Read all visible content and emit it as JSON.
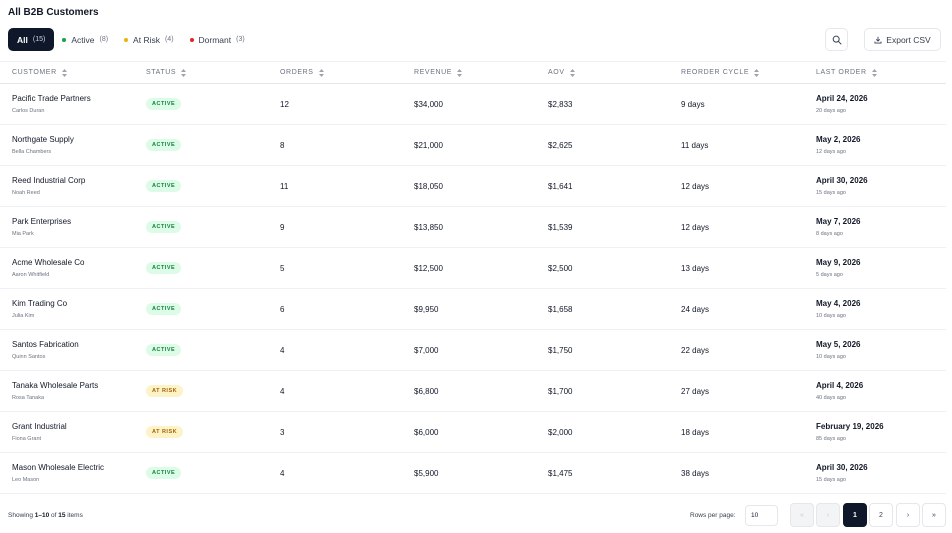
{
  "page": {
    "title": "All B2B Customers"
  },
  "filters": [
    {
      "label": "All",
      "count": "(15)",
      "dot": ""
    },
    {
      "label": "Active",
      "count": "(8)",
      "dot": "#16a34a"
    },
    {
      "label": "At Risk",
      "count": "(4)",
      "dot": "#eab308"
    },
    {
      "label": "Dormant",
      "count": "(3)",
      "dot": "#dc2626"
    }
  ],
  "toolbar": {
    "export_label": "Export CSV",
    "search_icon": "search-icon",
    "download_icon": "download-icon"
  },
  "columns": [
    "CUSTOMER",
    "STATUS",
    "ORDERS",
    "REVENUE",
    "AOV",
    "REORDER CYCLE",
    "LAST ORDER"
  ],
  "rows": [
    {
      "name": "Pacific Trade Partners",
      "contact": "Carlos Duran",
      "status": "ACTIVE",
      "status_kind": "active",
      "orders": "12",
      "revenue": "$34,000",
      "aov": "$2,833",
      "cycle": "9 days",
      "last_order": "April 24, 2026",
      "ago": "20 days ago"
    },
    {
      "name": "Northgate Supply",
      "contact": "Bella Chambers",
      "status": "ACTIVE",
      "status_kind": "active",
      "orders": "8",
      "revenue": "$21,000",
      "aov": "$2,625",
      "cycle": "11 days",
      "last_order": "May 2, 2026",
      "ago": "12 days ago"
    },
    {
      "name": "Reed Industrial Corp",
      "contact": "Noah Reed",
      "status": "ACTIVE",
      "status_kind": "active",
      "orders": "11",
      "revenue": "$18,050",
      "aov": "$1,641",
      "cycle": "12 days",
      "last_order": "April 30, 2026",
      "ago": "15 days ago"
    },
    {
      "name": "Park Enterprises",
      "contact": "Mia Park",
      "status": "ACTIVE",
      "status_kind": "active",
      "orders": "9",
      "revenue": "$13,850",
      "aov": "$1,539",
      "cycle": "12 days",
      "last_order": "May 7, 2026",
      "ago": "8 days ago"
    },
    {
      "name": "Acme Wholesale Co",
      "contact": "Aaron Whitfield",
      "status": "ACTIVE",
      "status_kind": "active",
      "orders": "5",
      "revenue": "$12,500",
      "aov": "$2,500",
      "cycle": "13 days",
      "last_order": "May 9, 2026",
      "ago": "5 days ago"
    },
    {
      "name": "Kim Trading Co",
      "contact": "Julia Kim",
      "status": "ACTIVE",
      "status_kind": "active",
      "orders": "6",
      "revenue": "$9,950",
      "aov": "$1,658",
      "cycle": "24 days",
      "last_order": "May 4, 2026",
      "ago": "10 days ago"
    },
    {
      "name": "Santos Fabrication",
      "contact": "Quinn Santos",
      "status": "ACTIVE",
      "status_kind": "active",
      "orders": "4",
      "revenue": "$7,000",
      "aov": "$1,750",
      "cycle": "22 days",
      "last_order": "May 5, 2026",
      "ago": "10 days ago"
    },
    {
      "name": "Tanaka Wholesale Parts",
      "contact": "Rosa Tanaka",
      "status": "AT RISK",
      "status_kind": "risk",
      "orders": "4",
      "revenue": "$6,800",
      "aov": "$1,700",
      "cycle": "27 days",
      "last_order": "April 4, 2026",
      "ago": "40 days ago"
    },
    {
      "name": "Grant Industrial",
      "contact": "Fiona Grant",
      "status": "AT RISK",
      "status_kind": "risk",
      "orders": "3",
      "revenue": "$6,000",
      "aov": "$2,000",
      "cycle": "18 days",
      "last_order": "February 19, 2026",
      "ago": "85 days ago"
    },
    {
      "name": "Mason Wholesale Electric",
      "contact": "Leo Mason",
      "status": "ACTIVE",
      "status_kind": "active",
      "orders": "4",
      "revenue": "$5,900",
      "aov": "$1,475",
      "cycle": "38 days",
      "last_order": "April 30, 2026",
      "ago": "15 days ago"
    }
  ],
  "footer": {
    "showing_prefix": "Showing ",
    "showing_range": "1–10",
    "showing_of": " of ",
    "showing_total": "15",
    "showing_suffix": " items",
    "rows_per_page_label": "Rows per page:",
    "rows_per_page_value": "10"
  },
  "pagination": [
    {
      "label": "«",
      "state": "disabled",
      "name": "first-page-button"
    },
    {
      "label": "‹",
      "state": "disabled",
      "name": "prev-page-button"
    },
    {
      "label": "1",
      "state": "current",
      "name": "page-1-button"
    },
    {
      "label": "2",
      "state": "normal",
      "name": "page-2-button"
    },
    {
      "label": "›",
      "state": "normal",
      "name": "next-page-button"
    },
    {
      "label": "»",
      "state": "normal",
      "name": "last-page-button"
    }
  ]
}
